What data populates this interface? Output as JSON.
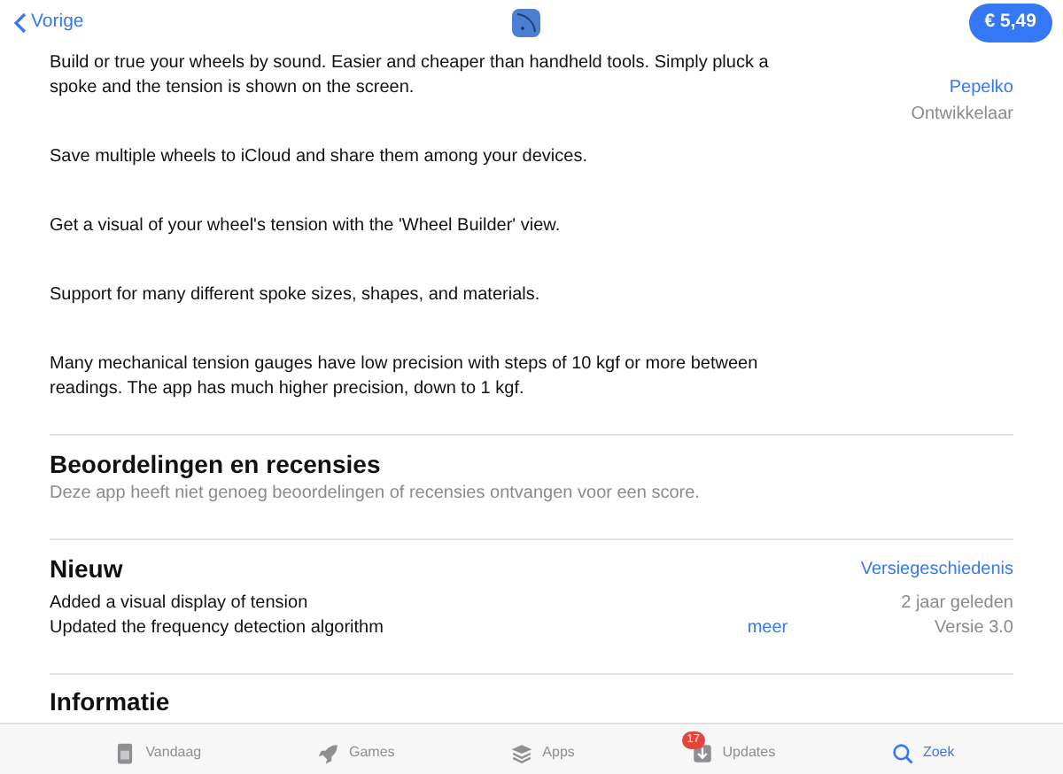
{
  "nav": {
    "back": "Vorige",
    "price": "€ 5,49"
  },
  "description": [
    "Build or true your wheels by sound.  Easier and cheaper than handheld tools. Simply pluck a spoke and the tension is shown on the screen.",
    "Save multiple wheels to iCloud and share them among your devices.",
    "Get a visual of your wheel's tension with the 'Wheel Builder' view.",
    "Support for many different spoke sizes, shapes, and materials.",
    "Many mechanical tension gauges have low precision with steps of 10 kgf or more between readings.  The app has much higher precision, down to 1 kgf."
  ],
  "developer": {
    "name": "Pepelko",
    "role": "Ontwikkelaar"
  },
  "ratings": {
    "title": "Beoordelingen en recensies",
    "text": "Deze app heeft niet genoeg beoordelingen of recensies ontvangen voor een score."
  },
  "whats_new": {
    "title": "Nieuw",
    "history_link": "Versiegeschiedenis",
    "notes": [
      "Added a visual display of tension",
      "Updated the frequency detection algorithm"
    ],
    "more": "meer",
    "date": "2 jaar geleden",
    "version": "Versie 3.0"
  },
  "info": {
    "title": "Informatie"
  },
  "tabs": [
    {
      "label": "Vandaag",
      "kind": "today",
      "selected": false
    },
    {
      "label": "Games",
      "kind": "rocket",
      "selected": false
    },
    {
      "label": "Apps",
      "kind": "layers",
      "selected": false
    },
    {
      "label": "Updates",
      "kind": "download",
      "selected": false,
      "badge": "17"
    },
    {
      "label": "Zoek",
      "kind": "search",
      "selected": true
    }
  ]
}
